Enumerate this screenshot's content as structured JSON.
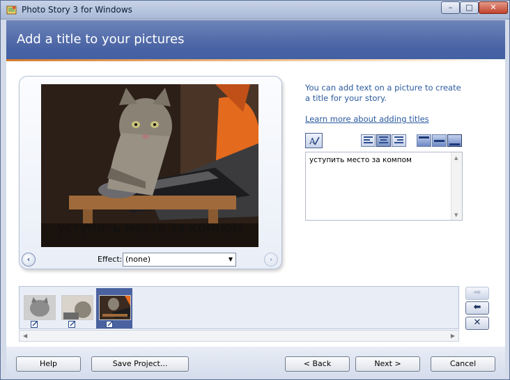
{
  "window": {
    "title": "Photo Story 3 for Windows",
    "controls": {
      "minimize": "–",
      "maximize": "□",
      "close": "✕"
    }
  },
  "header": {
    "title": "Add a title to your pictures"
  },
  "preview": {
    "caption": "уступить место за компом",
    "effect_label": "Effect:",
    "effect_value": "(none)",
    "prev_icon": "‹",
    "next_icon": "›"
  },
  "sidebar": {
    "info_text": "You can add text on a picture to create a title for your story.",
    "learn_link": "Learn more about adding titles",
    "title_text": "уступить место за компом",
    "alignment": {
      "horizontal_selected": "center",
      "vertical_selected": "bottom"
    }
  },
  "filmstrip": {
    "thumbnails": [
      {
        "name": "cat-1",
        "selected": false
      },
      {
        "name": "cat-2",
        "selected": false
      },
      {
        "name": "cat-3",
        "selected": true
      }
    ]
  },
  "side_buttons": {
    "forward": "➡",
    "back": "⬅",
    "remove": "✕"
  },
  "buttons": {
    "help": "Help",
    "save_project": "Save Project...",
    "back": "< Back",
    "next": "Next >",
    "cancel": "Cancel"
  },
  "colors": {
    "accent": "#4a64a4",
    "link": "#2a5aa0",
    "selected_thumb": "#4b62a0"
  }
}
